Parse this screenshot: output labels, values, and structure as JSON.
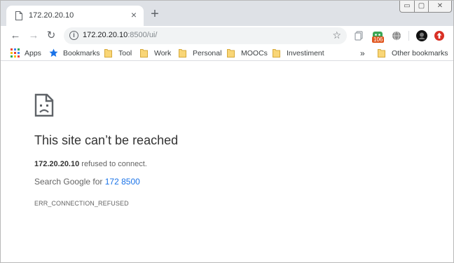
{
  "tab": {
    "title": "172.20.20.10",
    "close": "×"
  },
  "newtab": "+",
  "window_controls": {
    "minimize": "▭",
    "maximize": "▢",
    "close": "✕"
  },
  "nav": {
    "back": "←",
    "forward": "→",
    "reload": "↻"
  },
  "omnibox": {
    "host": "172.20.20.10",
    "path": ":8500/ui/",
    "info": "i",
    "star": "☆"
  },
  "extensions": {
    "badge_count": "106"
  },
  "bookmarks": {
    "items": [
      {
        "label": "Apps",
        "icon": "apps-grid-icon"
      },
      {
        "label": "Bookmarks",
        "icon": "star-icon"
      },
      {
        "label": "Tool",
        "icon": "folder-icon"
      },
      {
        "label": "Work",
        "icon": "folder-icon"
      },
      {
        "label": "Personal",
        "icon": "folder-icon"
      },
      {
        "label": "MOOCs",
        "icon": "folder-icon"
      },
      {
        "label": "Investiment",
        "icon": "folder-icon"
      }
    ],
    "overflow": "»",
    "other": "Other bookmarks"
  },
  "error": {
    "headline": "This site can’t be reached",
    "host": "172.20.20.10",
    "detail_suffix": " refused to connect.",
    "suggest_prefix": "Search Google for ",
    "suggest_link": "172 8500",
    "code": "ERR_CONNECTION_REFUSED"
  },
  "colors": {
    "accent": "#1a73e8",
    "tabstrip": "#dee1e6",
    "omnibox": "#f1f3f4",
    "folder": "#f9d677",
    "badge": "#e0541c"
  }
}
